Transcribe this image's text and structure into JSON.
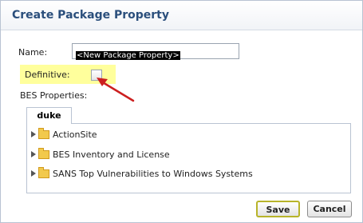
{
  "dialog": {
    "title": "Create Package Property",
    "name_label": "Name:",
    "name_value": "<New Package Property>",
    "definitive_label": "Definitive:",
    "definitive_checked": false,
    "bes_properties_label": "BES Properties:"
  },
  "tabs": [
    {
      "label": "duke"
    }
  ],
  "tree": {
    "items": [
      {
        "label": "ActionSite",
        "icon": "folder-icon"
      },
      {
        "label": "BES Inventory and License",
        "icon": "folder-icon"
      },
      {
        "label": "SANS Top Vulnerabilities to Windows Systems",
        "icon": "folder-icon"
      }
    ]
  },
  "buttons": {
    "save_label": "Save",
    "cancel_label": "Cancel"
  },
  "colors": {
    "title": "#2b4f7c",
    "highlight": "#ffff9c",
    "arrow": "#cc1f1f",
    "folder": "#f2c94c"
  }
}
